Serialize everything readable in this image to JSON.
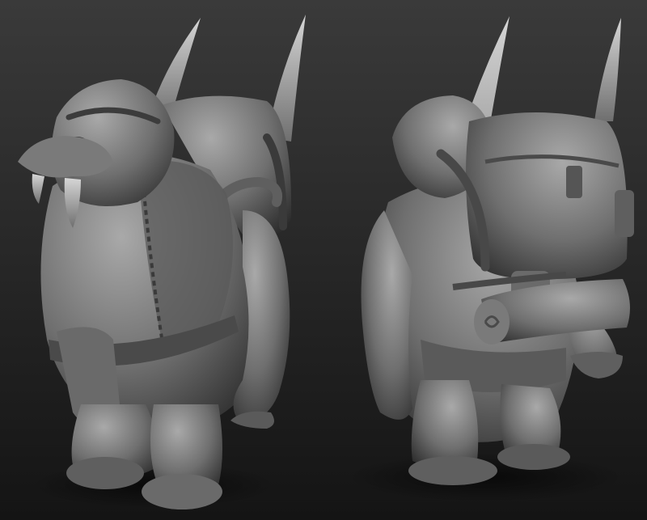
{
  "scene": {
    "background_top": "#3a3a3a",
    "background_bottom": "#141414",
    "clay_light": "#a9a9a9",
    "clay_mid": "#6f6f6f",
    "clay_dark": "#2c2c2c",
    "tusk_tip": "#d6d6d6"
  },
  "figures": [
    {
      "view": "front",
      "icon": "walrus-warrior-front-sculpt"
    },
    {
      "view": "back",
      "icon": "walrus-warrior-back-sculpt"
    }
  ]
}
